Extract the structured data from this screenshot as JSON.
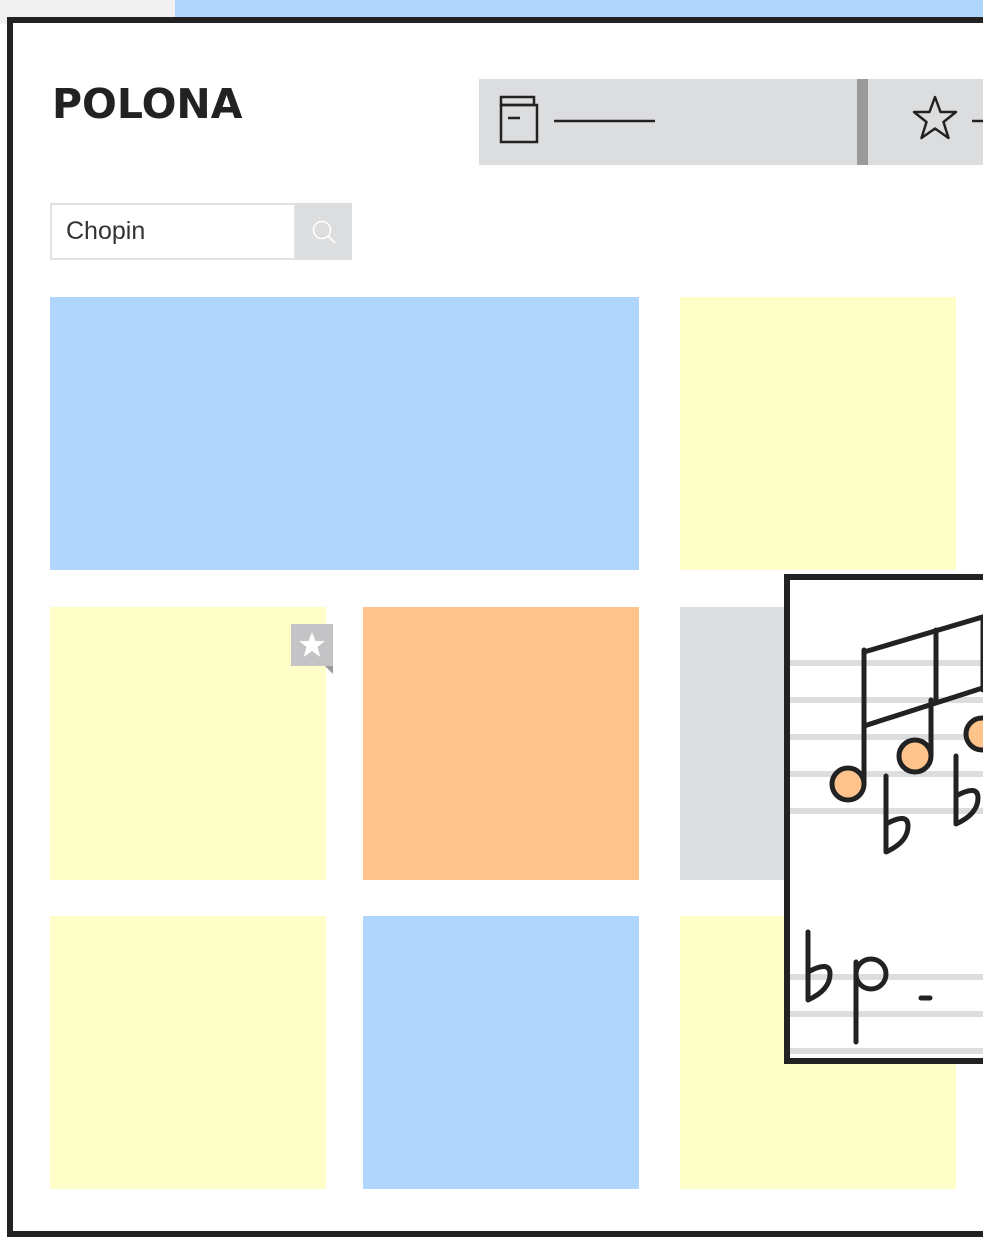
{
  "app": {
    "logo": "POLONA"
  },
  "toolbar": {
    "items": [
      {
        "icon": "archive-box-icon"
      },
      {
        "icon": "star-outline-icon"
      }
    ]
  },
  "search": {
    "value": "Chopin",
    "button_icon": "search-icon"
  },
  "tiles": [
    {
      "color": "#b0d6fd"
    },
    {
      "color": "#fefec8"
    },
    {
      "color": "#fefec8",
      "favorite": true
    },
    {
      "color": "#fec48c"
    },
    {
      "color": "#dcdddf"
    },
    {
      "color": "#fefec8"
    },
    {
      "color": "#b0d6fd"
    },
    {
      "color": "#fefec8"
    }
  ],
  "preview": {
    "icon": "sheet-music-icon"
  },
  "colors": {
    "frame": "#222222",
    "blue": "#b0d6fd",
    "yellow": "#fefec8",
    "orange": "#fec48c",
    "grey": "#dcdddf",
    "note_fill": "#fec48c"
  }
}
